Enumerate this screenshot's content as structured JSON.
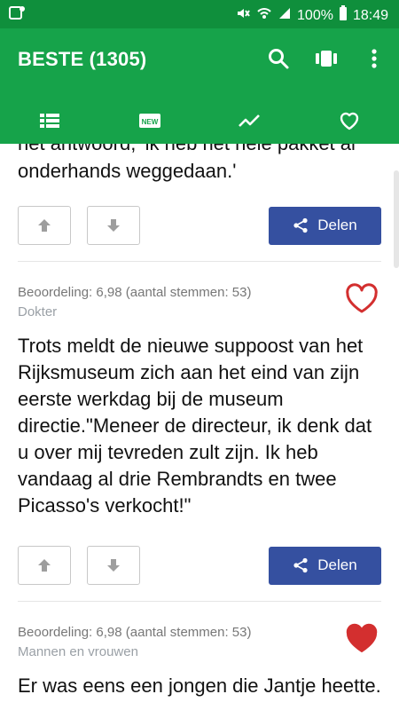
{
  "status": {
    "percent": "100%",
    "time": "18:49"
  },
  "appbar": {
    "title": "BESTE (1305)"
  },
  "cards": [
    {
      "text_cut": "het antwoord, 'ik heb het hele pakket al onderhands weggedaan.'",
      "share_label": "Delen"
    },
    {
      "meta": "Beoordeling: 6,98 (aantal stemmen: 53)",
      "category": "Dokter",
      "text": "Trots meldt de nieuwe suppoost van het Rijksmuseum zich aan het eind van zijn eerste werkdag bij de museum directie.\"Meneer de directeur, ik denk dat u over mij tevreden zult zijn. Ik heb vandaag al drie Rembrandts en twee Picasso's verkocht!\"",
      "favorite": false,
      "share_label": "Delen"
    },
    {
      "meta": "Beoordeling: 6,98 (aantal stemmen: 53)",
      "category": "Mannen en vrouwen",
      "text": "Er was eens een jongen die Jantje heette.",
      "favorite": true
    }
  ],
  "icons": {
    "notification": "notification-icon",
    "mute": "mute-icon",
    "wifi": "wifi-icon",
    "signal": "signal-icon",
    "battery": "battery-icon",
    "search": "search-icon",
    "cards": "cards-icon",
    "menu": "more-vert-icon",
    "tab_list": "list-icon",
    "tab_new": "new-icon",
    "tab_trending": "trending-icon",
    "tab_favorites": "heart-icon",
    "vote_up": "arrow-up-icon",
    "vote_down": "arrow-down-icon",
    "share": "share-icon"
  },
  "colors": {
    "statusbar": "#0f8f3c",
    "appbar": "#16a34a",
    "share": "#3550a0",
    "heart": "#d32f2f"
  }
}
